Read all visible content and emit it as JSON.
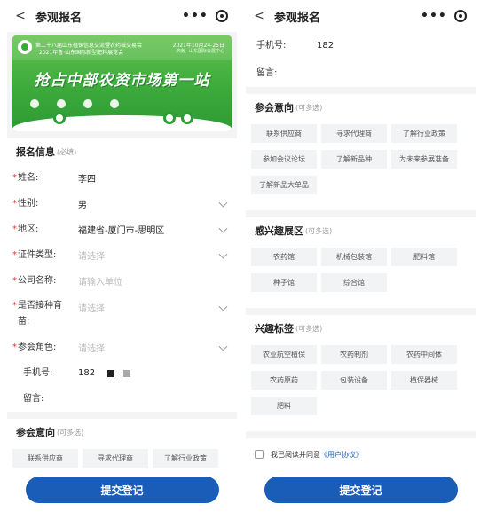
{
  "app": {
    "title": "参观报名",
    "back_glyph": "<",
    "more_glyph": "•••"
  },
  "banner": {
    "line1": "第二十八届山东植保信息交流暨农药械交易会",
    "line2": "2021年鲁·山东国际新型肥料展览会",
    "date": "2021年10月24-25日",
    "venue": "济南 · 山东国际会展中心",
    "slogan": "抢占中部农资市场第一站"
  },
  "form": {
    "section_title": "报名信息",
    "section_hint": "(必填)",
    "fields": [
      {
        "label": "姓名:",
        "value": "李四",
        "required": true
      },
      {
        "label": "性别:",
        "value": "男",
        "required": true
      },
      {
        "label": "地区:",
        "value": "福建省-厦门市-思明区",
        "required": true
      },
      {
        "label": "证件类型:",
        "placeholder": "请选择",
        "required": true
      },
      {
        "label": "公司名称:",
        "placeholder": "请输入单位",
        "required": true
      },
      {
        "label": "是否接种育苗:",
        "placeholder": "请选择",
        "required": true
      },
      {
        "label": "参会角色:",
        "placeholder": "请选择",
        "required": true
      },
      {
        "label": "手机号:",
        "value": "182",
        "required": false
      },
      {
        "label": "留言:",
        "value": "",
        "required": false
      }
    ]
  },
  "intent": {
    "title": "参会意向",
    "hint": "(可多选)",
    "options": [
      "联系供应商",
      "寻求代理商",
      "了解行业政策",
      "参加会议论坛",
      "了解新品种",
      "为未来参展准备",
      "了解新品大单品"
    ],
    "left_cut": [
      "联系供应商",
      "寻求代理商",
      "了解行业政策"
    ]
  },
  "halls": {
    "title": "感兴趣展区",
    "hint": "(可多选)",
    "options": [
      "农药馆",
      "机械包装馆",
      "肥料馆",
      "种子馆",
      "综合馆"
    ]
  },
  "interest_tags": {
    "title": "兴趣标签",
    "hint": "(可多选)",
    "options": [
      "农业航空植保",
      "农药制剂",
      "农药中间体",
      "农药原药",
      "包装设备",
      "植保器械",
      "肥料"
    ]
  },
  "agreement": {
    "text": "我已阅读并同意",
    "link": "《用户协议》"
  },
  "submit_label": "提交登记",
  "right_top": {
    "phone_label": "手机号:",
    "phone_value": "182",
    "message_label": "留言:"
  }
}
